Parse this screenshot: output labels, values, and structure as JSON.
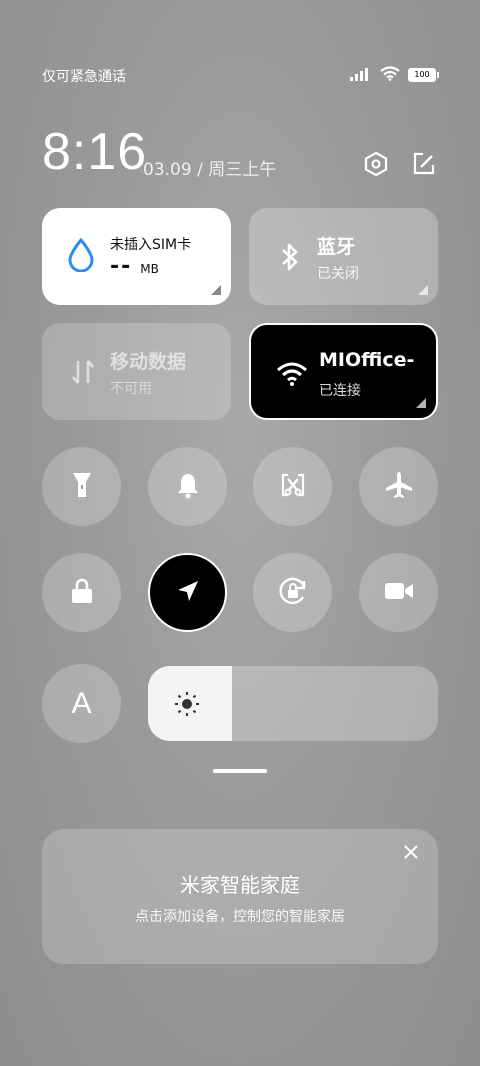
{
  "status_bar": {
    "carrier_text": "仅可紧急通话",
    "battery_level": "100"
  },
  "header": {
    "time": "8:16",
    "date": "03.09 / 周三上午"
  },
  "tiles": {
    "sim": {
      "title": "未插入SIM卡",
      "value": "--",
      "unit": "MB"
    },
    "bluetooth": {
      "title": "蓝牙",
      "status": "已关闭"
    },
    "mobile_data": {
      "title": "移动数据",
      "status": "不可用"
    },
    "wifi": {
      "title": "MIOffice-",
      "status": "已连接"
    }
  },
  "toggles": {
    "flashlight": "flashlight-icon",
    "silent": "bell-icon",
    "screenshot": "screenshot-icon",
    "airplane": "airplane-icon",
    "lock": "lock-icon",
    "location": "location-icon",
    "rotation_lock": "rotation-lock-icon",
    "screen_record": "video-icon",
    "font": "A"
  },
  "brightness": {
    "level": 0.29
  },
  "smart_home_card": {
    "title": "米家智能家庭",
    "subtitle": "点击添加设备，控制您的智能家居"
  },
  "colors": {
    "active_tile_bg": "#ffffff",
    "wifi_tile_bg": "#000000",
    "accent_blue": "#2f8cf0"
  }
}
